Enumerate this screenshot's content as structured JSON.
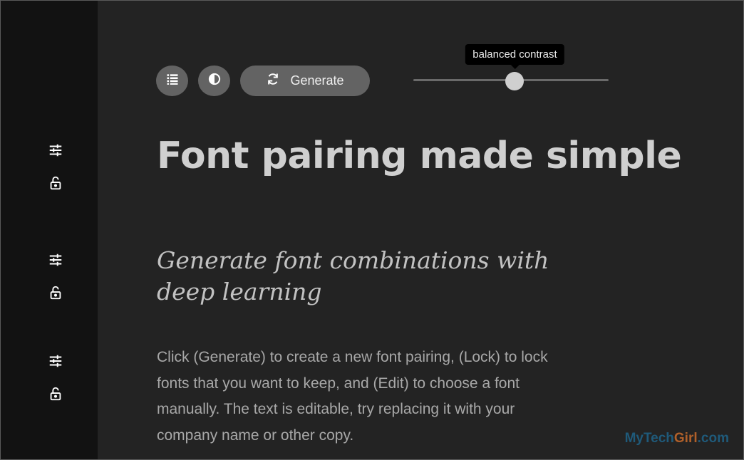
{
  "sidebar": {
    "groups": [
      {
        "edit_icon": "sliders-icon",
        "lock_icon": "unlock-icon"
      },
      {
        "edit_icon": "sliders-icon",
        "lock_icon": "unlock-icon"
      },
      {
        "edit_icon": "sliders-icon",
        "lock_icon": "unlock-icon"
      }
    ]
  },
  "toolbar": {
    "list_icon": "list-icon",
    "contrast_icon": "contrast-icon",
    "generate_icon": "refresh-icon",
    "generate_label": "Generate"
  },
  "slider": {
    "tooltip": "balanced contrast",
    "value_fraction": 0.52
  },
  "content": {
    "headline": "Font pairing made simple",
    "subheadline": "Generate font combinations with deep learning",
    "body": "Click (Generate) to create a new font pairing, (Lock) to lock fonts that you want to keep, and (Edit) to choose a font manually. The text is editable, try replacing it with your company name or other copy."
  },
  "watermark": {
    "part1": "My",
    "part2": "Tech",
    "part3": "Girl",
    "part4": ".com"
  },
  "colors": {
    "sidebar_bg": "#121212",
    "main_bg": "#232323",
    "button_bg": "#636363",
    "thumb": "#cfcfcf"
  }
}
